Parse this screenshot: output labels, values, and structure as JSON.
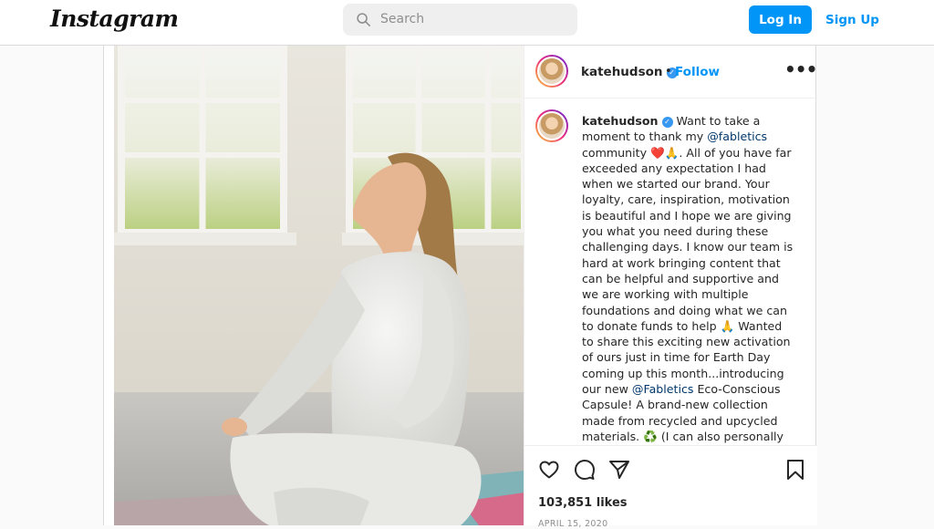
{
  "nav": {
    "logo": "Instagram",
    "search_placeholder": "Search",
    "login_label": "Log In",
    "signup_label": "Sign Up",
    "accent_color": "#0095f6"
  },
  "post": {
    "username": "katehudson",
    "verified": true,
    "follow_label": "Follow",
    "separator": "•",
    "more_icon": "more-horizontal-icon",
    "caption": {
      "username": "katehudson",
      "t1": " Want to take a moment to thank my ",
      "m1": "@fabletics",
      "t2": " community ❤️🙏. All of you have far exceeded any expectation I had when we started our brand. Your loyalty, care, inspiration, motivation is beautiful and I hope we are giving you what you need during these challenging days. I know our team is hard at work bringing content that can be helpful and supportive and we are working with multiple foundations and doing what we can to donate funds to help 🙏 Wanted to share this exciting new activation of ours just in time for Earth Day coming up this month...introducing our new ",
      "m2": "@Fabletics",
      "t3": " Eco-Conscious Capsule! A brand-new collection made from recycled and upcycled materials. ♻️ (I can also personally attest to it being"
    },
    "likes": "103,851 likes",
    "date": "APRIL 15, 2020",
    "action_icons": [
      "heart-icon",
      "comment-icon",
      "share-icon",
      "bookmark-icon"
    ]
  }
}
